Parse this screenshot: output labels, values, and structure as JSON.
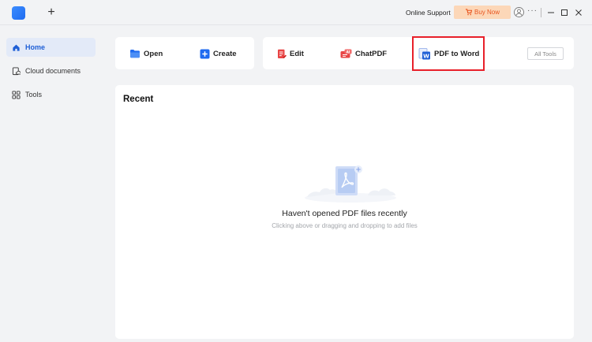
{
  "titlebar": {
    "new_tab_label": "+",
    "online_support": "Online Support",
    "buy_now": "Buy Now",
    "more": "···"
  },
  "sidebar": {
    "items": [
      {
        "label": "Home",
        "icon": "home-icon",
        "active": true
      },
      {
        "label": "Cloud documents",
        "icon": "cloud-document-icon",
        "active": false
      },
      {
        "label": "Tools",
        "icon": "tools-grid-icon",
        "active": false
      }
    ]
  },
  "toolbar": {
    "open_label": "Open",
    "create_label": "Create",
    "edit_label": "Edit",
    "chatpdf_label": "ChatPDF",
    "pdf_to_word_label": "PDF to Word",
    "all_tools_label": "All Tools"
  },
  "recent": {
    "title": "Recent",
    "empty_title": "Haven't opened PDF files recently",
    "empty_subtitle": "Clicking above or dragging and dropping to add files"
  },
  "colors": {
    "accent": "#1f6bf0",
    "buy_now_bg": "#fcd7b8",
    "buy_now_text": "#e8541e",
    "highlight": "#e8202a"
  }
}
